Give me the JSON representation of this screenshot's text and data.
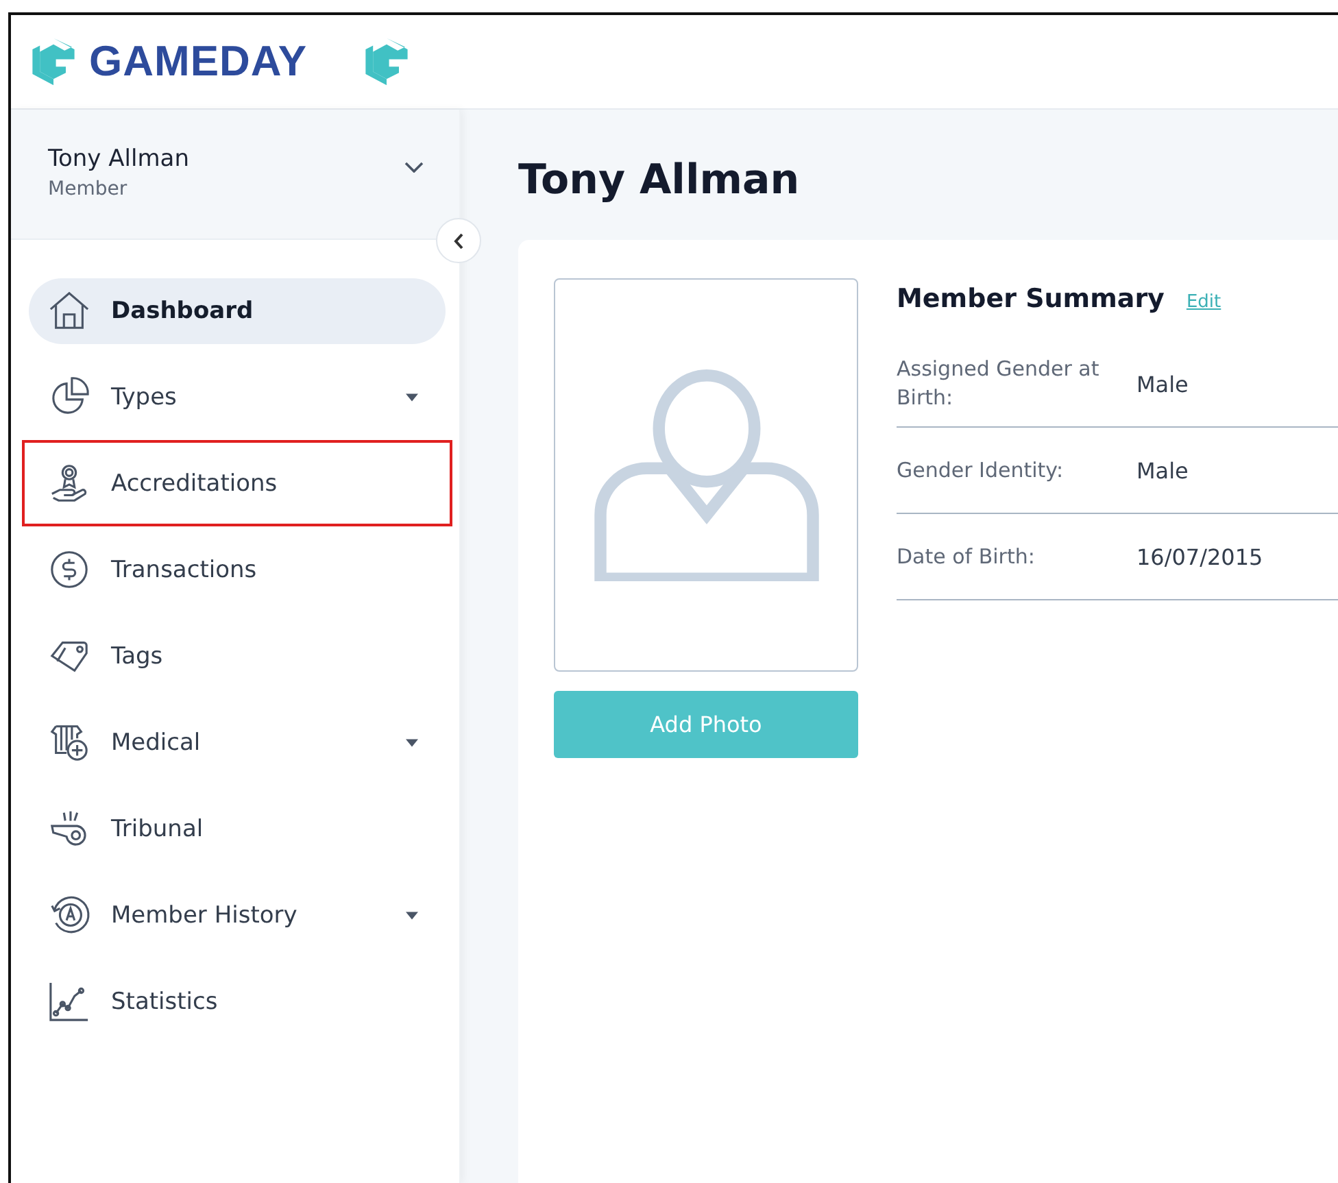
{
  "header": {
    "brand": "GAMEDAY"
  },
  "user": {
    "name": "Tony Allman",
    "role": "Member"
  },
  "nav": [
    {
      "label": "Dashboard",
      "selected": true,
      "expandable": false,
      "highlighted": false
    },
    {
      "label": "Types",
      "selected": false,
      "expandable": true,
      "highlighted": false
    },
    {
      "label": "Accreditations",
      "selected": false,
      "expandable": false,
      "highlighted": true
    },
    {
      "label": "Transactions",
      "selected": false,
      "expandable": false,
      "highlighted": false
    },
    {
      "label": "Tags",
      "selected": false,
      "expandable": false,
      "highlighted": false
    },
    {
      "label": "Medical",
      "selected": false,
      "expandable": true,
      "highlighted": false
    },
    {
      "label": "Tribunal",
      "selected": false,
      "expandable": false,
      "highlighted": false
    },
    {
      "label": "Member History",
      "selected": false,
      "expandable": true,
      "highlighted": false
    },
    {
      "label": "Statistics",
      "selected": false,
      "expandable": false,
      "highlighted": false
    }
  ],
  "page": {
    "title": "Tony Allman"
  },
  "photo": {
    "button": "Add Photo"
  },
  "summary": {
    "title": "Member Summary",
    "edit": "Edit",
    "fields": [
      {
        "label": "Assigned Gender at Birth:",
        "value": "Male"
      },
      {
        "label": "Gender Identity:",
        "value": "Male"
      },
      {
        "label": "Date of Birth:",
        "value": "16/07/2015"
      }
    ]
  }
}
